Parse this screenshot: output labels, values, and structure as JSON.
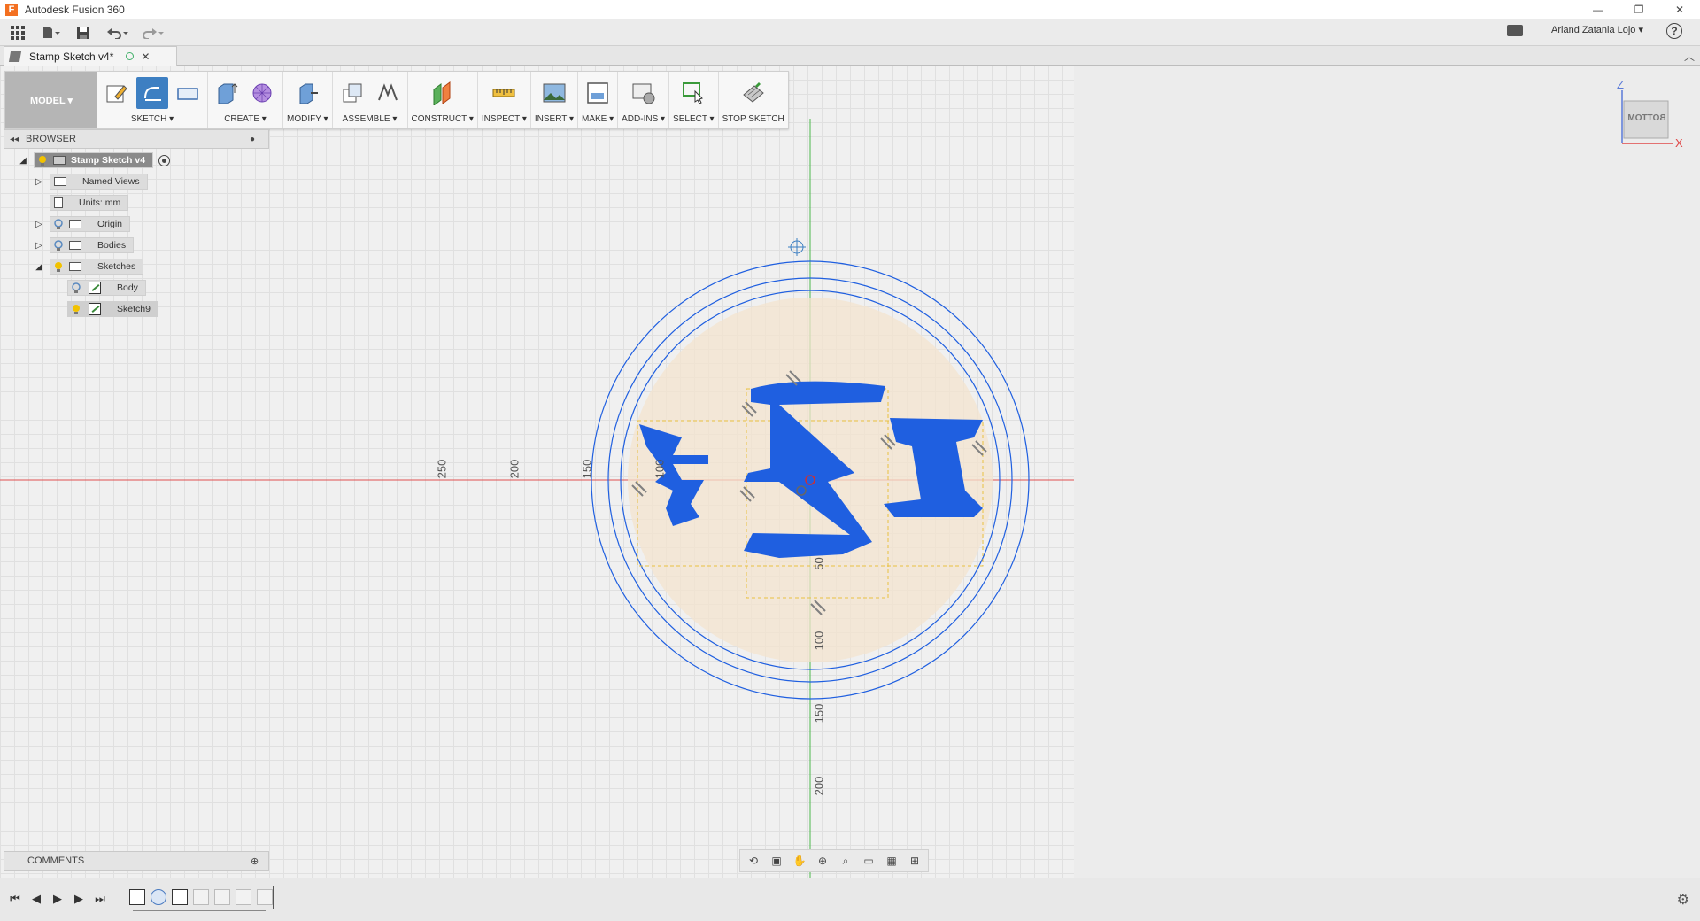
{
  "window": {
    "app_title": "Autodesk Fusion 360",
    "minimize": "—",
    "restore": "❐",
    "close": "✕"
  },
  "qat": {
    "user_name": "Arland Zatania Lojo ▾",
    "help_label": "?"
  },
  "document": {
    "tab_title": "Stamp Sketch v4*",
    "close_label": "✕"
  },
  "toolbar": {
    "workspace": "MODEL ▾",
    "groups": [
      {
        "label": "SKETCH ▾"
      },
      {
        "label": "CREATE ▾"
      },
      {
        "label": "MODIFY ▾"
      },
      {
        "label": "ASSEMBLE ▾"
      },
      {
        "label": "CONSTRUCT ▾"
      },
      {
        "label": "INSPECT ▾"
      },
      {
        "label": "INSERT ▾"
      },
      {
        "label": "MAKE ▾"
      },
      {
        "label": "ADD-INS ▾"
      },
      {
        "label": "SELECT ▾"
      },
      {
        "label": "STOP SKETCH"
      }
    ]
  },
  "browser": {
    "title": "BROWSER",
    "items": [
      {
        "label": "Stamp Sketch v4"
      },
      {
        "label": "Named Views"
      },
      {
        "label": "Units: mm"
      },
      {
        "label": "Origin"
      },
      {
        "label": "Bodies"
      },
      {
        "label": "Sketches"
      },
      {
        "label": "Body"
      },
      {
        "label": "Sketch9"
      }
    ]
  },
  "comments": {
    "title": "COMMENTS"
  },
  "viewcube": {
    "face": "BOTTOM",
    "z_axis": "Z",
    "x_axis": "X"
  },
  "dimensions": {
    "horizontal": [
      "250",
      "200",
      "150",
      "100"
    ],
    "vertical": [
      "50",
      "100",
      "150",
      "200"
    ]
  },
  "colors": {
    "sketch_blue": "#1f5fe0",
    "profile_fill": "#f4e4cf",
    "x_axis_red": "#e05050",
    "y_axis_green": "#4cb84c",
    "dash_yellow": "#e8c040",
    "accent_active": "#3d7fc2"
  }
}
